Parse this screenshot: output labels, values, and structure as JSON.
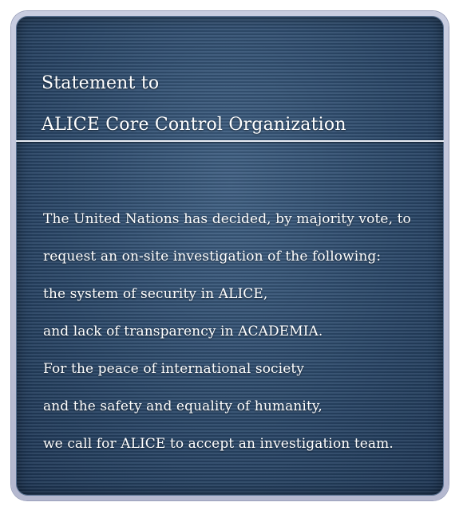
{
  "statement": {
    "heading": [
      "Statement to",
      "ALICE Core Control Organization"
    ],
    "body": [
      "The United Nations has decided, by majority vote, to",
      "request an on-site investigation of the following:",
      "the system of security in ALICE,",
      "and lack of transparency in ACADEMIA.",
      "For the peace of international society",
      "and the safety and equality of humanity,",
      "we call for ALICE to accept an investigation team."
    ]
  }
}
